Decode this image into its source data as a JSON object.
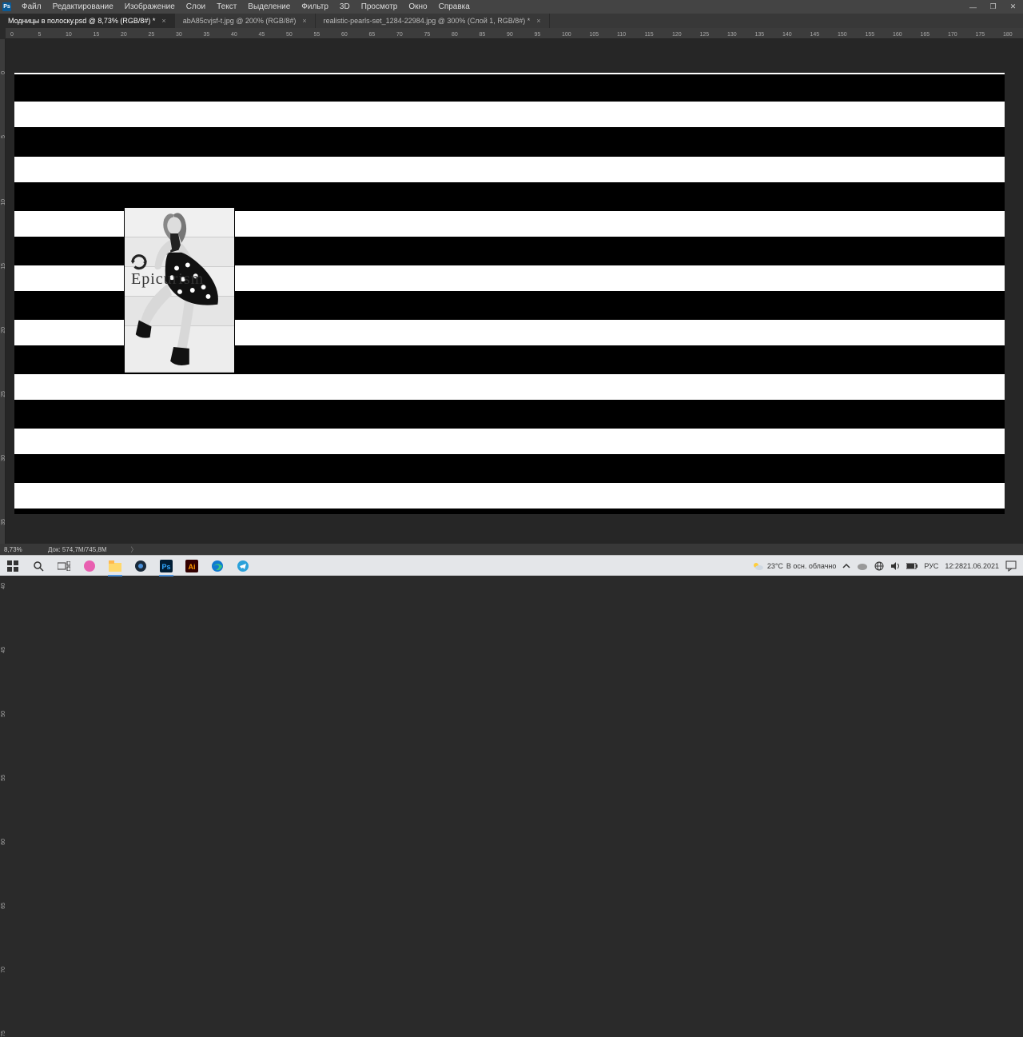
{
  "app": {
    "icon_label": "Ps"
  },
  "menu": {
    "items": [
      "Файл",
      "Редактирование",
      "Изображение",
      "Слои",
      "Текст",
      "Выделение",
      "Фильтр",
      "3D",
      "Просмотр",
      "Окно",
      "Справка"
    ]
  },
  "window_controls": {
    "minimize": "—",
    "maximize": "❐",
    "close": "✕"
  },
  "tabs": [
    {
      "label": "Модницы в полоску.psd @ 8,73% (RGB/8#) *",
      "active": true
    },
    {
      "label": "abA85cvjsf-t.jpg @ 200% (RGB/8#)",
      "active": false
    },
    {
      "label": "realistic-pearls-set_1284-22984.jpg @ 300% (Слой 1, RGB/8#) *",
      "active": false
    }
  ],
  "ruler_h": [
    "0",
    "5",
    "10",
    "15",
    "20",
    "25",
    "30",
    "35",
    "40",
    "45",
    "50",
    "55",
    "60",
    "65",
    "70",
    "75",
    "80",
    "85",
    "90",
    "95",
    "100",
    "105",
    "110",
    "115",
    "120",
    "125",
    "130",
    "135",
    "140",
    "145",
    "150",
    "155",
    "160",
    "165",
    "170",
    "175",
    "180"
  ],
  "ruler_v": [
    "0",
    "5",
    "10",
    "15",
    "20",
    "25",
    "30",
    "35",
    "40",
    "45",
    "50",
    "55",
    "60",
    "65",
    "70",
    "75"
  ],
  "canvas": {
    "overlay_text": "Epicurism",
    "rotate_icon": "rotate-icon"
  },
  "status": {
    "zoom": "8,73%",
    "doc": "Док: 574,7M/745,8M",
    "arrow": "〉"
  },
  "taskbar": {
    "icons": [
      "start",
      "search",
      "taskview",
      "app1",
      "explorer",
      "app2",
      "photoshop",
      "illustrator",
      "edge",
      "telegram"
    ],
    "weather_temp": "23°C",
    "weather_text": "В осн. облачно",
    "tray_icons": [
      "chevron-up",
      "onedrive",
      "net",
      "sound",
      "battery"
    ],
    "lang": "РУС",
    "time": "12:28",
    "date": "21.06.2021",
    "notif": "quote-icon"
  }
}
